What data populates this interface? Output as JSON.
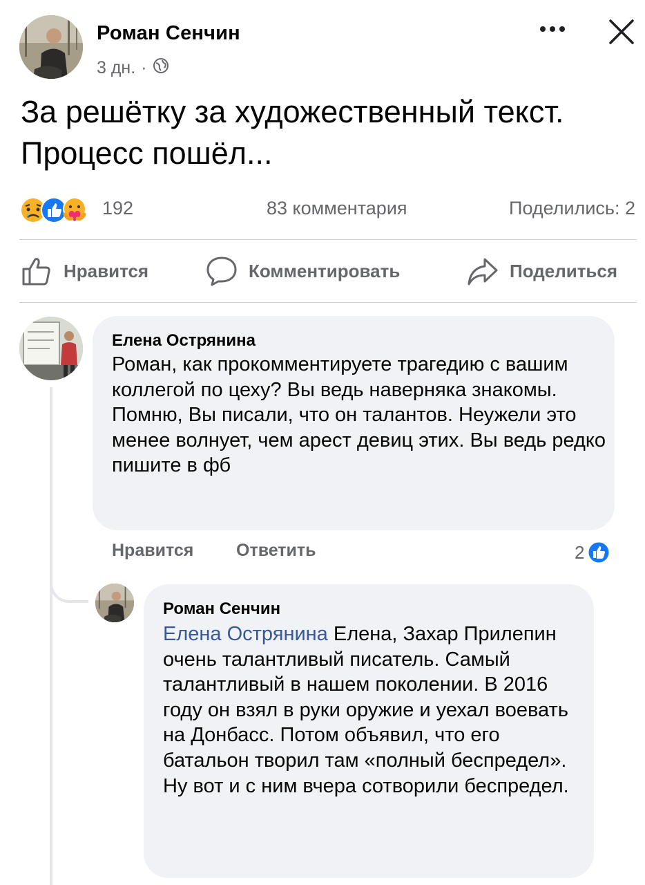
{
  "post": {
    "author": "Роман Сенчин",
    "time": "3 дн.",
    "meta_separator": "·",
    "privacy_icon": "globe-icon",
    "text": "За решётку за художественный текст. Процесс пошёл...",
    "more_icon": "more-horizontal-icon",
    "close_icon": "close-icon"
  },
  "reactions": {
    "icons": [
      "sad-reaction-icon",
      "like-reaction-icon",
      "care-reaction-icon"
    ],
    "count": "192",
    "comments": "83 комментария",
    "shares": "Поделились: 2"
  },
  "actions": {
    "like": "Нравится",
    "comment": "Комментировать",
    "share": "Поделиться"
  },
  "comments": [
    {
      "author": "Елена Острянина",
      "text": "Роман, как прокомментируете трагедию с вашим коллегой по цеху? Вы ведь наверняка знакомы. Помню, Вы писали, что он талантов. Неужели это менее волнует, чем арест девиц этих. Вы ведь редко пишите в фб",
      "like_label": "Нравится",
      "reply_label": "Ответить",
      "like_count": "2",
      "replies": [
        {
          "author": "Роман Сенчин",
          "mention": "Елена Острянина",
          "text": " Елена, Захар Прилепин очень талантливый писатель. Самый талантливый в нашем поколении. В 2016 году он взял в руки оружие и уехал воевать на Донбасс. Потом объявил, что его батальон творил там «полный беспредел». Ну вот и с ним вчера сотворили беспредел."
        }
      ]
    }
  ],
  "colors": {
    "like_blue": "#1877f2",
    "secondary_text": "#65676b",
    "bubble_bg": "#f0f2f5",
    "mention": "#385898"
  }
}
